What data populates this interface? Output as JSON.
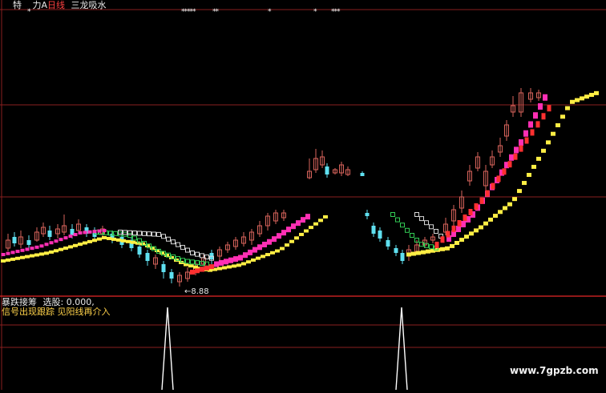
{
  "header": {
    "items": [
      {
        "text": "特",
        "color": "#e8e8e8"
      },
      {
        "text": "力A",
        "color": "#e8e8e8"
      },
      {
        "text": "日线",
        "color": "#ff4040"
      },
      {
        "text": "三龙吸水",
        "color": "#e8e8e8"
      }
    ],
    "signal_marks": [
      "*",
      "*****",
      "**",
      "*",
      "*",
      "***"
    ]
  },
  "main_chart": {
    "low_marker_label": "8.88",
    "colors": {
      "up_candle": "#d9645c",
      "down_candle": "#5fe0f0",
      "line_fast": "#ff2fb4",
      "line_mid": "#ff3030",
      "line_slow": "#ffee44",
      "line_green": "#33cc55",
      "line_white": "#d8d8d8",
      "grid": "#8a1f1f"
    }
  },
  "sub_chart": {
    "title": "暴跌接筹",
    "value_label": "选股: 0.000,",
    "text_color": "#ffd24a",
    "signal_text": "信号出现跟踪  见阳线再介入"
  },
  "watermark": "www.7gpzb.com"
}
